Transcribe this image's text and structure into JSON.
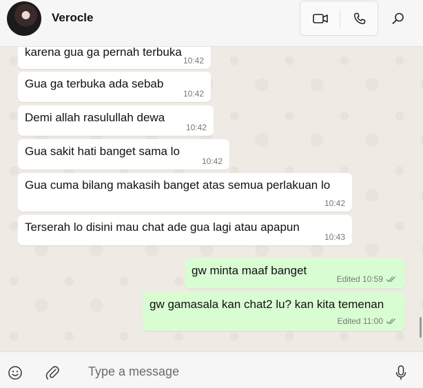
{
  "header": {
    "contact_name": "Verocle",
    "icons": [
      "video-call-icon",
      "voice-call-icon",
      "search-icon"
    ]
  },
  "messages": [
    {
      "direction": "in",
      "text": "karena gua ga pernah terbuka",
      "time": "10:42"
    },
    {
      "direction": "in",
      "text": "Gua ga terbuka ada sebab",
      "time": "10:42"
    },
    {
      "direction": "in",
      "text": "Demi allah rasulullah dewa",
      "time": "10:42"
    },
    {
      "direction": "in",
      "text": "Gua sakit hati banget sama lo",
      "time": "10:42"
    },
    {
      "direction": "in",
      "text": "Gua cuma bilang makasih banget atas semua perlakuan lo",
      "time": "10:42"
    },
    {
      "direction": "in",
      "text": "Terserah lo disini mau chat ade gua lagi atau apapun",
      "time": "10:43"
    },
    {
      "direction": "out",
      "text": "gw minta maaf banget",
      "time": "Edited 10:59",
      "status": "read"
    },
    {
      "direction": "out",
      "text": "gw gamasala kan chat2 lu? kan kita temenan",
      "time": "Edited 11:00",
      "status": "read"
    }
  ],
  "composer": {
    "placeholder": "Type a message",
    "icons": [
      "emoji-icon",
      "attach-icon",
      "microphone-icon"
    ]
  },
  "colors": {
    "incoming_bubble": "#ffffff",
    "outgoing_bubble": "#d9fdd3",
    "chat_background": "#efeae4",
    "read_ticks": "#7a8a80"
  }
}
